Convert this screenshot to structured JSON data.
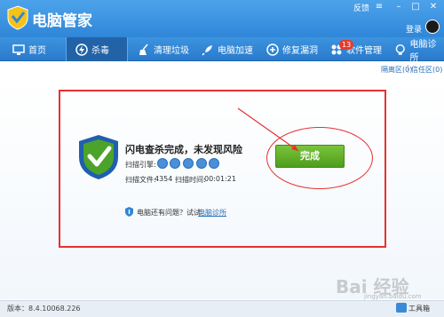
{
  "app": {
    "title": "电脑管家",
    "feedback": "反馈",
    "login": "登录"
  },
  "nav": {
    "items": [
      {
        "label": "首页",
        "icon": "monitor-icon"
      },
      {
        "label": "杀毒",
        "icon": "shield-lightning-icon",
        "active": true
      },
      {
        "label": "清理垃圾",
        "icon": "broom-icon"
      },
      {
        "label": "电脑加速",
        "icon": "rocket-icon"
      },
      {
        "label": "修复漏洞",
        "icon": "patch-icon"
      },
      {
        "label": "软件管理",
        "icon": "apps-icon",
        "badge": "13"
      },
      {
        "label": "电脑诊所",
        "icon": "bulb-icon"
      }
    ]
  },
  "sublinks": {
    "quarantine": "隔离区(0)",
    "trust": "信任区(0)"
  },
  "result": {
    "title": "闪电查杀完成，未发现风险",
    "engines_label": "扫描引擎:",
    "files_label": "扫描文件:",
    "files_value": "4354",
    "time_label": "扫描时间:",
    "time_value": "00:01:21",
    "hint": "电脑还有问题？试试",
    "hint_link": "电脑诊所",
    "done_button": "完成"
  },
  "status": {
    "version": "版本：8.4.10068.226",
    "toolbox": "工具箱"
  },
  "watermark": {
    "text": "Bai 经验",
    "sub": "jingyan.baidu.com"
  },
  "colors": {
    "title_bar": "#3a95e2",
    "nav_active": "#2263a8",
    "done_button": "#5fae28",
    "annotation_red": "#e83030",
    "shield_green": "#4ca32a"
  }
}
